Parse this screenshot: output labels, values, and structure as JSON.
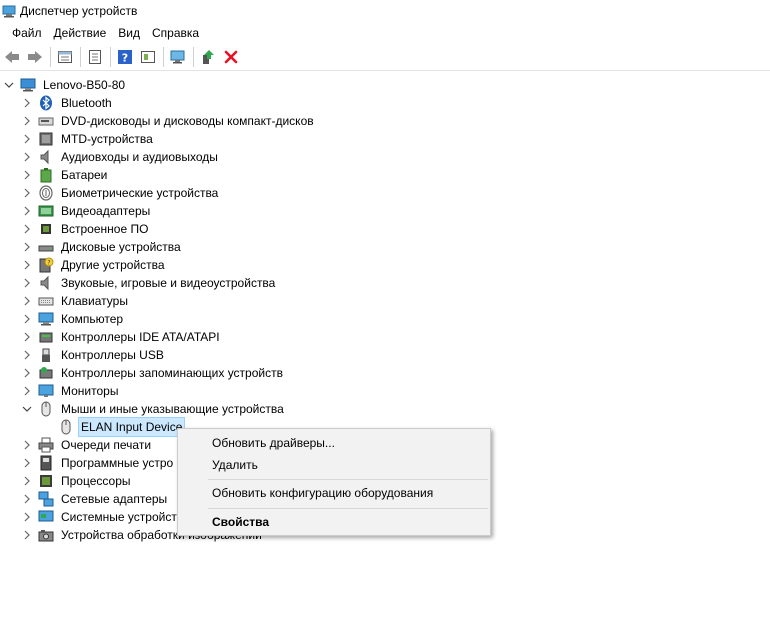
{
  "window": {
    "title": "Диспетчер устройств"
  },
  "menu": [
    "Файл",
    "Действие",
    "Вид",
    "Справка"
  ],
  "toolbar": {
    "buttons": [
      "back-icon",
      "forward-icon",
      "properties-icon",
      "list-icon",
      "help-icon",
      "view-icon",
      "monitor-scan-icon",
      "update-driver-icon",
      "uninstall-icon"
    ]
  },
  "tree": {
    "root": "Lenovo-B50-80",
    "categories": [
      "Bluetooth",
      "DVD-дисководы и дисководы компакт-дисков",
      "MTD-устройства",
      "Аудиовходы и аудиовыходы",
      "Батареи",
      "Биометрические устройства",
      "Видеоадаптеры",
      "Встроенное ПО",
      "Дисковые устройства",
      "Другие устройства",
      "Звуковые, игровые и видеоустройства",
      "Клавиатуры",
      "Компьютер",
      "Контроллеры IDE ATA/ATAPI",
      "Контроллеры USB",
      "Контроллеры запоминающих устройств",
      "Мониторы",
      "Мыши и иные указывающие устройства"
    ],
    "expanded_child": "ELAN Input Device",
    "after": [
      "Очереди печати",
      "Программные устро",
      "Процессоры",
      "Сетевые адаптеры",
      "Системные устройст",
      "Устройства обработки изображений"
    ]
  },
  "context_menu": {
    "update_driver": "Обновить драйверы...",
    "uninstall": "Удалить",
    "scan_hardware": "Обновить конфигурацию оборудования",
    "properties": "Свойства"
  },
  "colors": {
    "selection": "#cce8ff",
    "selection_border": "#99d1ff",
    "delete_red": "#e81123",
    "menu_bg": "#f2f2f2"
  }
}
